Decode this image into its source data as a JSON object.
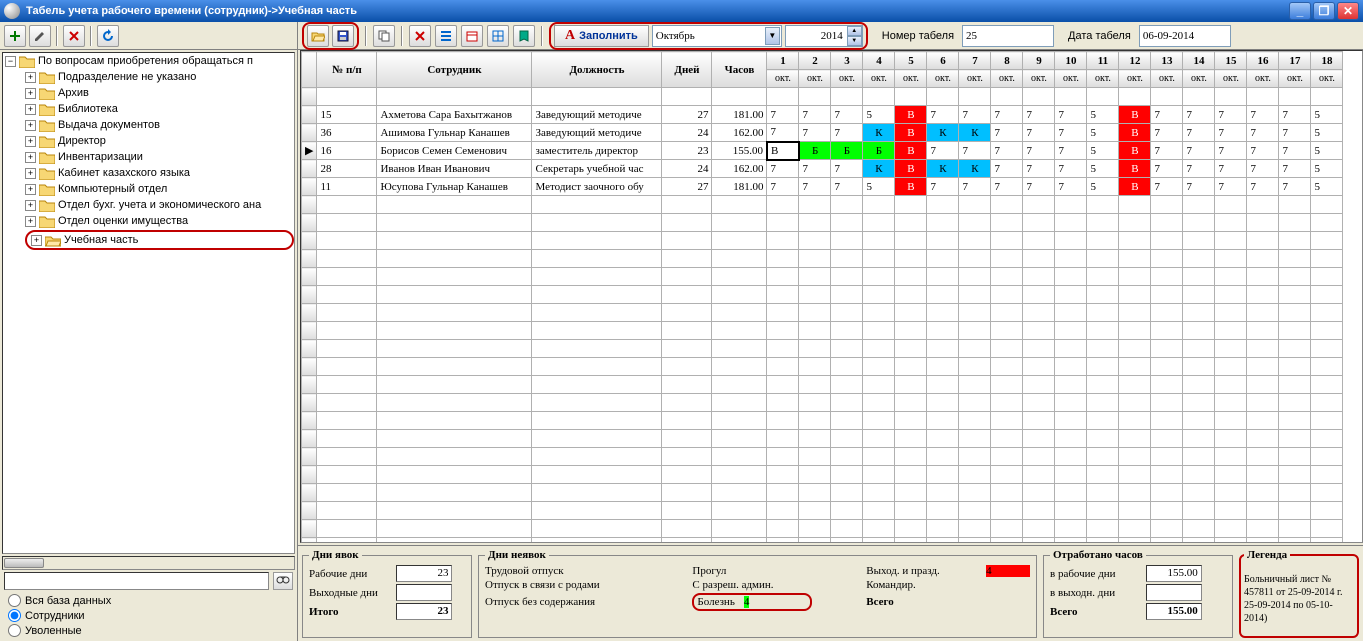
{
  "title": "Табель учета рабочего времени (сотрудник)->Учебная часть",
  "toolbar_left": {
    "add": "+",
    "edit": "✎",
    "del": "✖",
    "ref": "↻"
  },
  "tree": {
    "root": "По вопросам приобретения обращаться п",
    "items": [
      "Подразделение не указано",
      "Архив",
      "Библиотека",
      "Выдача документов",
      "Директор",
      "Инвентаризации",
      "Кабинет казахского языка",
      "Компьютерный отдел",
      "Отдел бухг. учета и экономического ана",
      "Отдел оценки имущества",
      "Учебная часть"
    ],
    "selected_index": 10
  },
  "radios": {
    "all": "Вся база данных",
    "emp": "Сотрудники",
    "fired": "Уволенные"
  },
  "top": {
    "fill": "Заполнить",
    "month": "Октябрь",
    "year": "2014",
    "num_label": "Номер табеля",
    "num": "25",
    "date_label": "Дата табеля",
    "date": "06-09-2014"
  },
  "grid": {
    "cols": {
      "mark": "",
      "npp": "№ п/п",
      "emp": "Сотрудник",
      "pos": "Должность",
      "days": "Дней",
      "hours": "Часов"
    },
    "day_nums": [
      "1",
      "2",
      "3",
      "4",
      "5",
      "6",
      "7",
      "8",
      "9",
      "10",
      "11",
      "12",
      "13",
      "14",
      "15",
      "16",
      "17",
      "18"
    ],
    "day_sub": "окт.",
    "rows": [
      {
        "mark": "",
        "npp": "15",
        "emp": "Ахметова Сара Бахытжанов",
        "pos": "Заведующий методиче",
        "days": "27",
        "hours": "181.00",
        "cells": [
          {
            "v": "7"
          },
          {
            "v": "7"
          },
          {
            "v": "7"
          },
          {
            "v": "5"
          },
          {
            "v": "В",
            "c": "B"
          },
          {
            "v": "7"
          },
          {
            "v": "7"
          },
          {
            "v": "7"
          },
          {
            "v": "7"
          },
          {
            "v": "7"
          },
          {
            "v": "5"
          },
          {
            "v": "В",
            "c": "B"
          },
          {
            "v": "7"
          },
          {
            "v": "7"
          },
          {
            "v": "7"
          },
          {
            "v": "7"
          },
          {
            "v": "7"
          },
          {
            "v": "5"
          }
        ]
      },
      {
        "mark": "",
        "npp": "36",
        "emp": "Ашимова Гульнар Канашев",
        "pos": "Заведующий методиче",
        "days": "24",
        "hours": "162.00",
        "cells": [
          {
            "v": "7"
          },
          {
            "v": "7"
          },
          {
            "v": "7"
          },
          {
            "v": "К",
            "c": "K"
          },
          {
            "v": "В",
            "c": "B"
          },
          {
            "v": "К",
            "c": "K"
          },
          {
            "v": "К",
            "c": "K"
          },
          {
            "v": "7"
          },
          {
            "v": "7"
          },
          {
            "v": "7"
          },
          {
            "v": "5"
          },
          {
            "v": "В",
            "c": "B"
          },
          {
            "v": "7"
          },
          {
            "v": "7"
          },
          {
            "v": "7"
          },
          {
            "v": "7"
          },
          {
            "v": "7"
          },
          {
            "v": "5"
          }
        ]
      },
      {
        "mark": "▶",
        "npp": "16",
        "emp": "Борисов Семен Семенович",
        "pos": "заместитель директор",
        "days": "23",
        "hours": "155.00",
        "cells": [
          {
            "v": "В",
            "c": "edit"
          },
          {
            "v": "Б",
            "c": "G"
          },
          {
            "v": "Б",
            "c": "G"
          },
          {
            "v": "Б",
            "c": "G"
          },
          {
            "v": "В",
            "c": "B"
          },
          {
            "v": "7"
          },
          {
            "v": "7"
          },
          {
            "v": "7"
          },
          {
            "v": "7"
          },
          {
            "v": "7"
          },
          {
            "v": "5"
          },
          {
            "v": "В",
            "c": "B"
          },
          {
            "v": "7"
          },
          {
            "v": "7"
          },
          {
            "v": "7"
          },
          {
            "v": "7"
          },
          {
            "v": "7"
          },
          {
            "v": "5"
          }
        ]
      },
      {
        "mark": "",
        "npp": "28",
        "emp": "Иванов Иван Иванович",
        "pos": "Секретарь учебной час",
        "days": "24",
        "hours": "162.00",
        "cells": [
          {
            "v": "7"
          },
          {
            "v": "7"
          },
          {
            "v": "7"
          },
          {
            "v": "К",
            "c": "K"
          },
          {
            "v": "В",
            "c": "B"
          },
          {
            "v": "К",
            "c": "K"
          },
          {
            "v": "К",
            "c": "K"
          },
          {
            "v": "7"
          },
          {
            "v": "7"
          },
          {
            "v": "7"
          },
          {
            "v": "5"
          },
          {
            "v": "В",
            "c": "B"
          },
          {
            "v": "7"
          },
          {
            "v": "7"
          },
          {
            "v": "7"
          },
          {
            "v": "7"
          },
          {
            "v": "7"
          },
          {
            "v": "5"
          }
        ]
      },
      {
        "mark": "",
        "npp": "11",
        "emp": "Юсупова Гульнар Канашев",
        "pos": "Методист заочного обу",
        "days": "27",
        "hours": "181.00",
        "cells": [
          {
            "v": "7"
          },
          {
            "v": "7"
          },
          {
            "v": "7"
          },
          {
            "v": "5"
          },
          {
            "v": "В",
            "c": "B"
          },
          {
            "v": "7"
          },
          {
            "v": "7"
          },
          {
            "v": "7"
          },
          {
            "v": "7"
          },
          {
            "v": "7"
          },
          {
            "v": "5"
          },
          {
            "v": "В",
            "c": "B"
          },
          {
            "v": "7"
          },
          {
            "v": "7"
          },
          {
            "v": "7"
          },
          {
            "v": "7"
          },
          {
            "v": "7"
          },
          {
            "v": "5"
          }
        ]
      }
    ]
  },
  "bottom": {
    "att": {
      "title": "Дни явок",
      "work": "Рабочие дни",
      "work_v": "23",
      "off": "Выходные дни",
      "off_v": "",
      "total": "Итого",
      "total_v": "23"
    },
    "abs": {
      "title": "Дни неявок",
      "vac": "Трудовой отпуск",
      "vac_v": "",
      "mat": "Отпуск в связи с родами",
      "mat_v": "",
      "unp": "Отпуск без содержания",
      "unp_v": "",
      "skip": "Прогул",
      "skip_v": "",
      "adm": "С разреш. админ.",
      "adm_v": "",
      "sick": "Болезнь",
      "sick_v": "4",
      "hol": "Выход. и празд.",
      "hol_v": "4",
      "trip": "Командир.",
      "trip_v": "",
      "tot": "Всего",
      "tot_v": ""
    },
    "hours": {
      "title": "Отработано часов",
      "work": "в рабочие дни",
      "work_v": "155.00",
      "off": "в выходн. дни",
      "off_v": "",
      "tot": "Всего",
      "tot_v": "155.00"
    },
    "legend": {
      "title": "Легенда",
      "text": "Больничный лист № 457811 от 25-09-2014 г. 25-09-2014 по 05-10-2014)"
    }
  }
}
